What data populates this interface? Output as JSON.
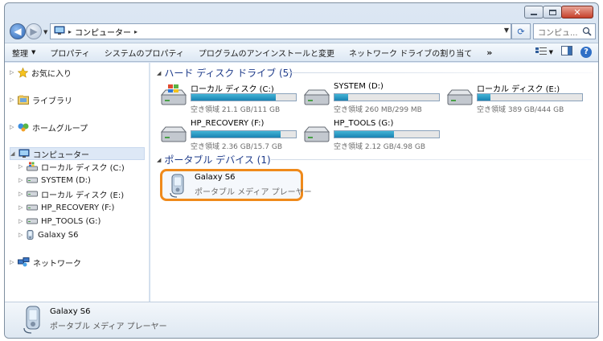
{
  "address": {
    "path": "コンピューター",
    "search_placeholder": "コンピュ..."
  },
  "toolbar": {
    "items": [
      "整理",
      "プロパティ",
      "システムのプロパティ",
      "プログラムのアンインストールと変更",
      "ネットワーク ドライブの割り当て",
      "»"
    ]
  },
  "nav": {
    "favorites": "お気に入り",
    "libraries": "ライブラリ",
    "homegroup": "ホームグループ",
    "computer": "コンピューター",
    "drives": [
      "ローカル ディスク (C:)",
      "SYSTEM (D:)",
      "ローカル ディスク (E:)",
      "HP_RECOVERY (F:)",
      "HP_TOOLS (G:)",
      "Galaxy S6"
    ],
    "network": "ネットワーク"
  },
  "hdd_group": {
    "title": "ハード ディスク ドライブ (5)",
    "drives": [
      {
        "name": "ローカル ディスク (C:)",
        "space": "空き領域 21.1 GB/111 GB",
        "used": 0.81
      },
      {
        "name": "SYSTEM (D:)",
        "space": "空き領域 260 MB/299 MB",
        "used": 0.13
      },
      {
        "name": "ローカル ディスク (E:)",
        "space": "空き領域 389 GB/444 GB",
        "used": 0.12
      },
      {
        "name": "HP_RECOVERY (F:)",
        "space": "空き領域 2.36 GB/15.7 GB",
        "used": 0.85
      },
      {
        "name": "HP_TOOLS (G:)",
        "space": "空き領域 2.12 GB/4.98 GB",
        "used": 0.57
      }
    ]
  },
  "portable_group": {
    "title": "ポータブル デバイス (1)",
    "device_name": "Galaxy S6",
    "device_type": "ポータブル メディア プレーヤー"
  },
  "details": {
    "name": "Galaxy S6",
    "type": "ポータブル メディア プレーヤー"
  },
  "colors": {
    "highlight_border": "#ef8a1b",
    "drive_bar": "#1a83b3",
    "group_header": "#1e3b8a"
  }
}
